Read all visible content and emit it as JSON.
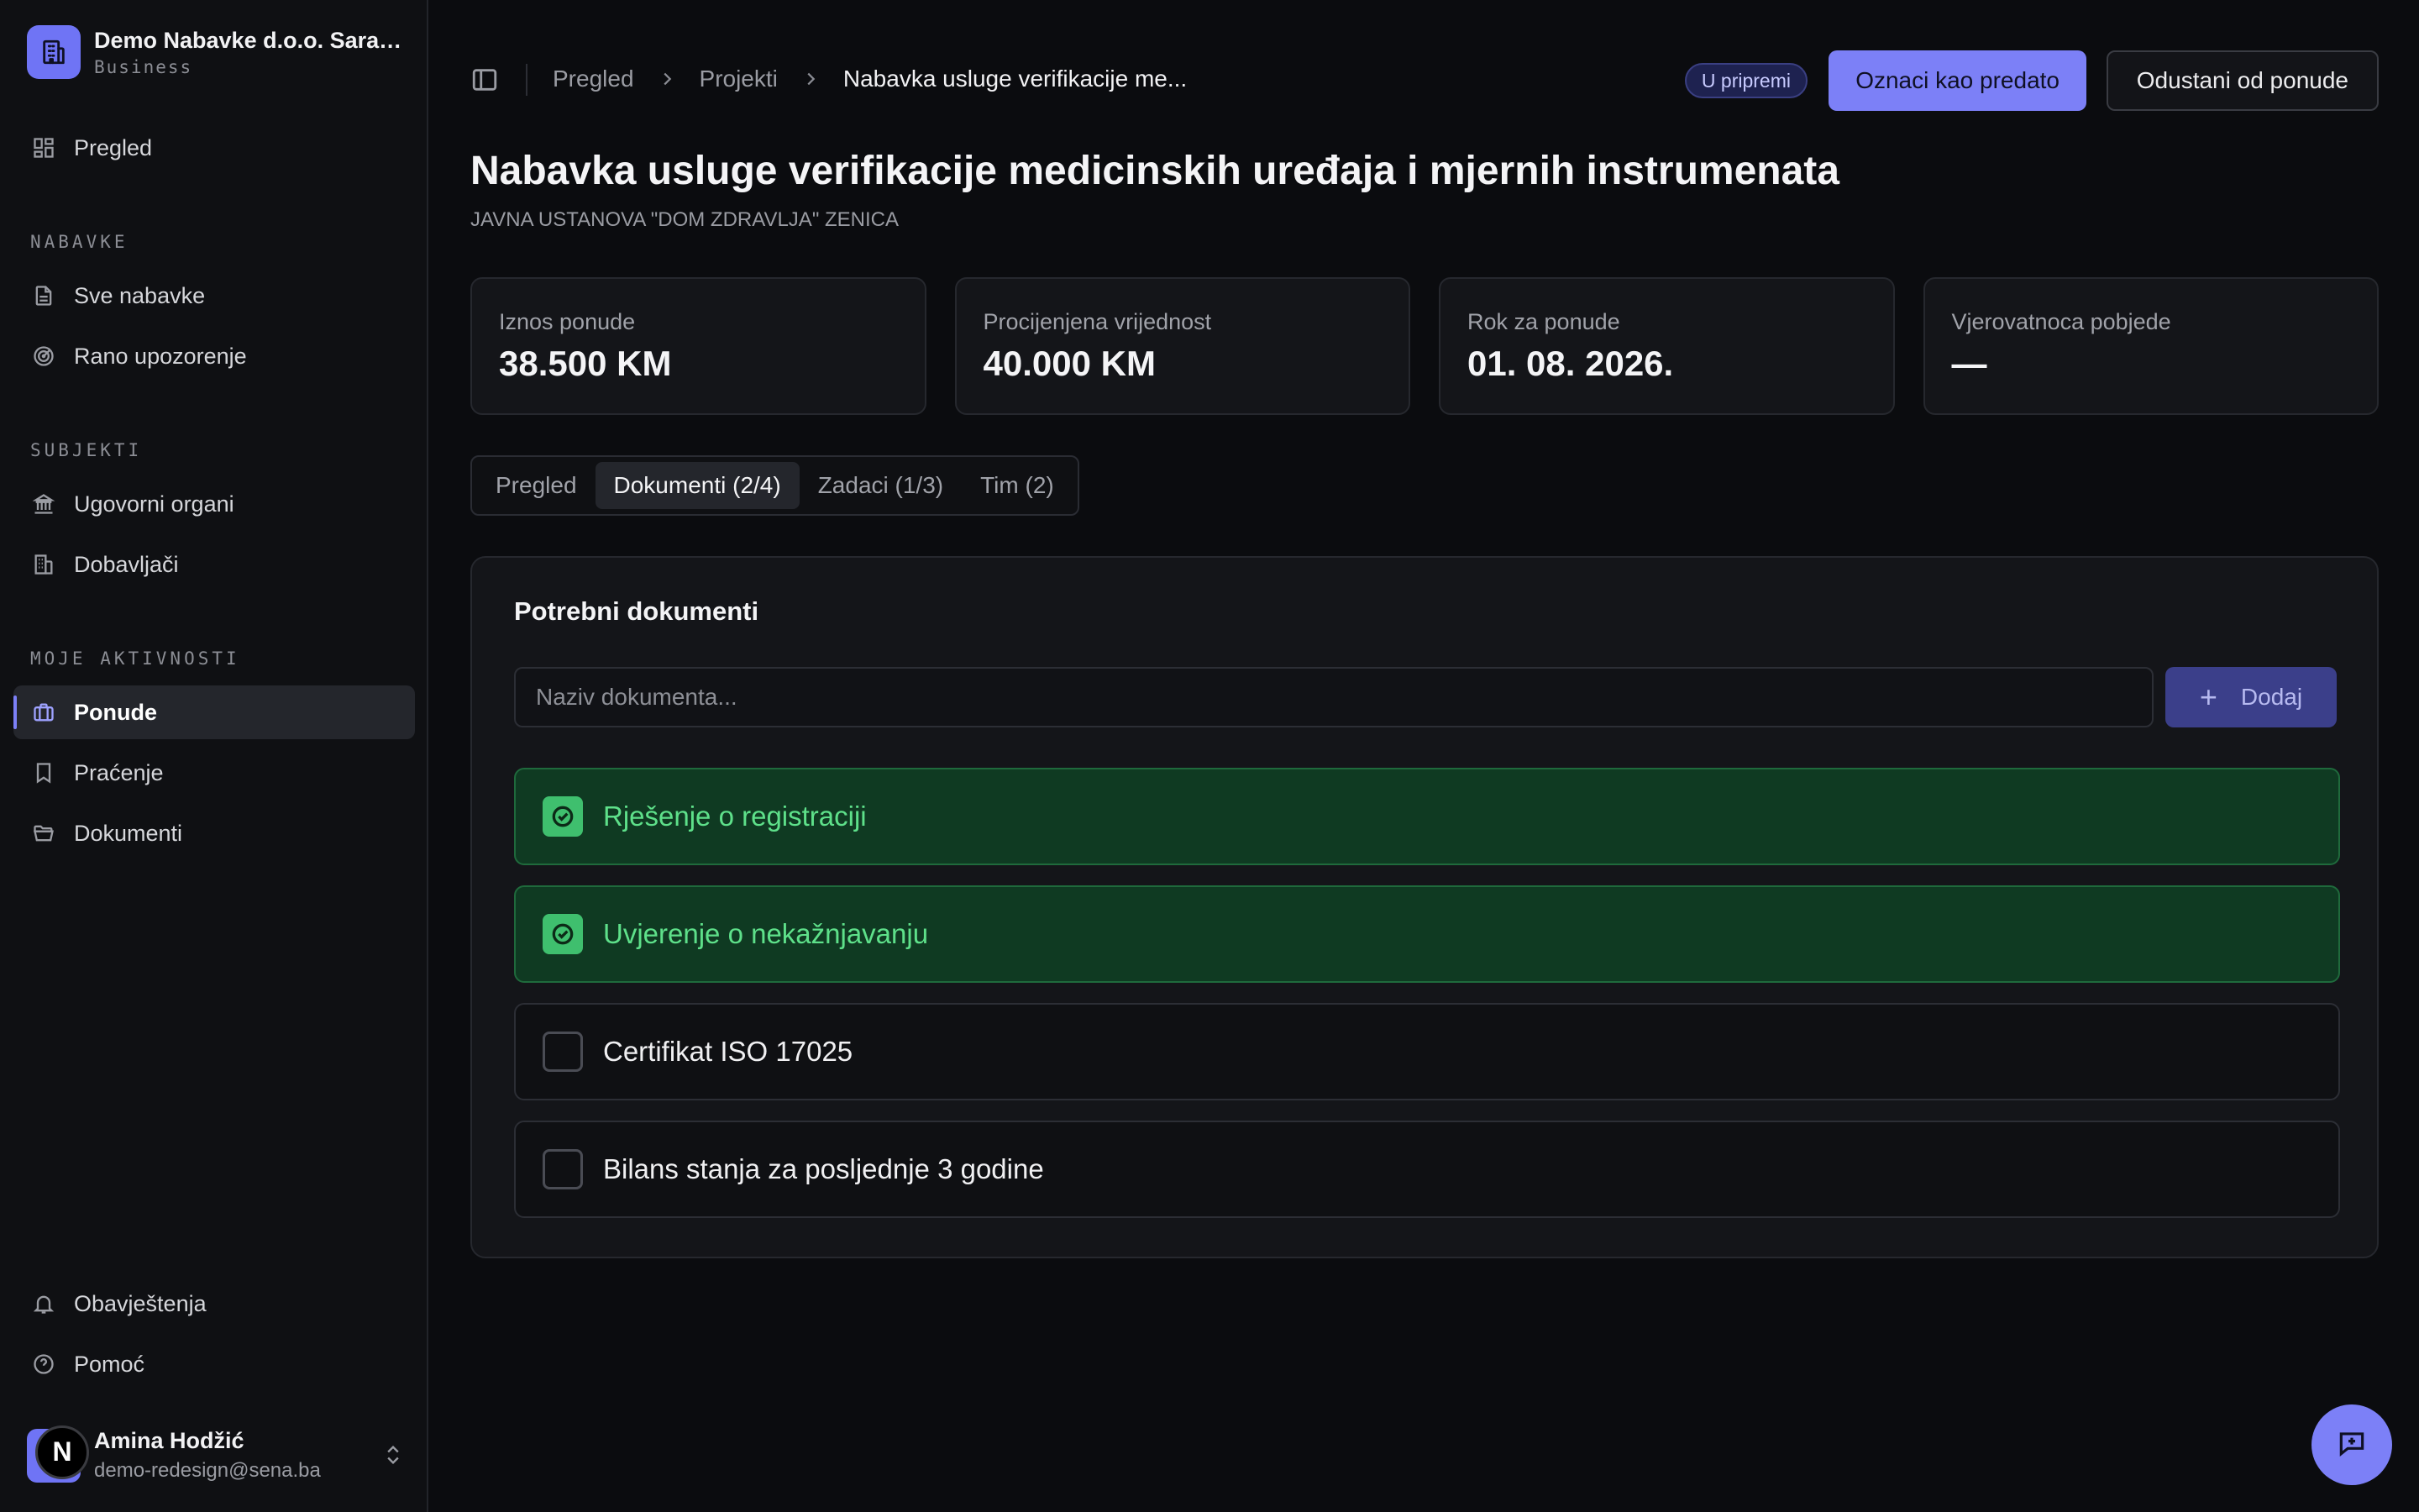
{
  "org": {
    "name": "Demo Nabavke d.o.o. Sarajevo",
    "plan": "Business"
  },
  "sidebar": {
    "overview": "Pregled",
    "sections": [
      {
        "label": "NABAVKE",
        "items": [
          "Sve nabavke",
          "Rano upozorenje"
        ]
      },
      {
        "label": "SUBJEKTI",
        "items": [
          "Ugovorni organi",
          "Dobavljači"
        ]
      },
      {
        "label": "MOJE AKTIVNOSTI",
        "items": [
          "Ponude",
          "Praćenje",
          "Dokumenti"
        ]
      }
    ],
    "bottom": [
      "Obavještenja",
      "Pomoć"
    ],
    "active": "Ponude"
  },
  "user": {
    "name": "Amina Hodžić",
    "email": "demo-redesign@sena.ba",
    "avatar_letter": "N"
  },
  "breadcrumb": [
    "Pregled",
    "Projekti",
    "Nabavka usluge verifikacije me..."
  ],
  "status_badge": "U pripremi",
  "actions": {
    "primary": "Oznaci kao predato",
    "secondary": "Odustani od ponude"
  },
  "page": {
    "title": "Nabavka usluge verifikacije medicinskih uređaja i mjernih instrumenata",
    "subtitle": "JAVNA USTANOVA \"DOM ZDRAVLJA\" ZENICA"
  },
  "stats": [
    {
      "label": "Iznos ponude",
      "value": "38.500 KM"
    },
    {
      "label": "Procijenjena vrijednost",
      "value": "40.000 KM"
    },
    {
      "label": "Rok za ponude",
      "value": "01. 08. 2026."
    },
    {
      "label": "Vjerovatnoca pobjede",
      "value": "—"
    }
  ],
  "tabs": [
    "Pregled",
    "Dokumenti (2/4)",
    "Zadaci (1/3)",
    "Tim (2)"
  ],
  "active_tab": "Dokumenti (2/4)",
  "documents": {
    "title": "Potrebni dokumenti",
    "input_placeholder": "Naziv dokumenta...",
    "add_label": "Dodaj",
    "items": [
      {
        "label": "Rješenje o registraciji",
        "done": true
      },
      {
        "label": "Uvjerenje o nekažnjavanju",
        "done": true
      },
      {
        "label": "Certifikat ISO 17025",
        "done": false
      },
      {
        "label": "Bilans stanja za posljednje 3 godine",
        "done": false
      }
    ]
  },
  "colors": {
    "accent": "#7c80f7",
    "success": "#3fbf6e",
    "success_bg": "#0f3a22",
    "background": "#0b0c0f"
  },
  "icons": [
    "building-icon",
    "dashboard-icon",
    "file-icon",
    "radar-icon",
    "landmark-icon",
    "buildings-icon",
    "briefcase-icon",
    "bookmark-icon",
    "folder-icon",
    "bell-icon",
    "help-icon",
    "chevrons-updown-icon",
    "panel-toggle-icon",
    "chevron-right-icon",
    "plus-icon",
    "check-circle-icon",
    "chat-plus-icon"
  ]
}
